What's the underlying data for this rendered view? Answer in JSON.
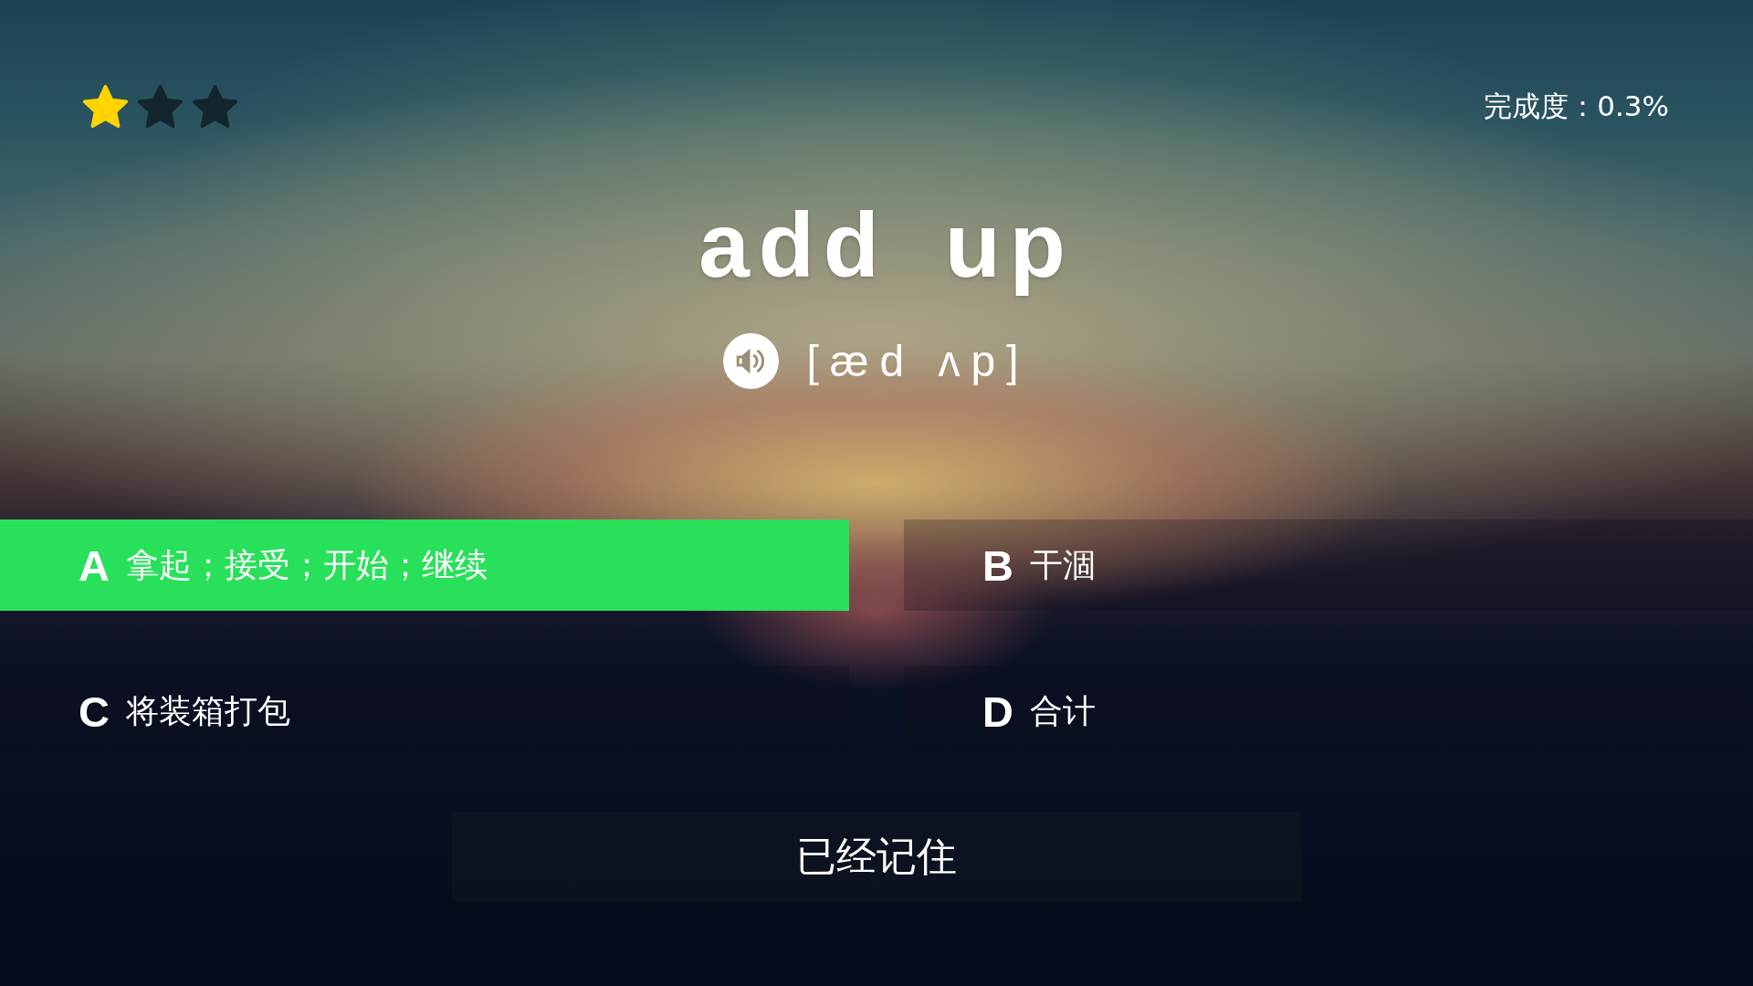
{
  "rating": {
    "stars": 1
  },
  "progress": {
    "label": "完成度：0.3%"
  },
  "word": {
    "text": "add up",
    "phonetic": "[æd ʌp]"
  },
  "options": [
    {
      "letter": "A",
      "meaning": "拿起；接受；开始；继续",
      "selected": true
    },
    {
      "letter": "B",
      "meaning": "干涸",
      "selected": false
    },
    {
      "letter": "C",
      "meaning": "将装箱打包",
      "selected": false
    },
    {
      "letter": "D",
      "meaning": "合计",
      "selected": false
    }
  ],
  "remember_button": {
    "label": "已经记住"
  }
}
